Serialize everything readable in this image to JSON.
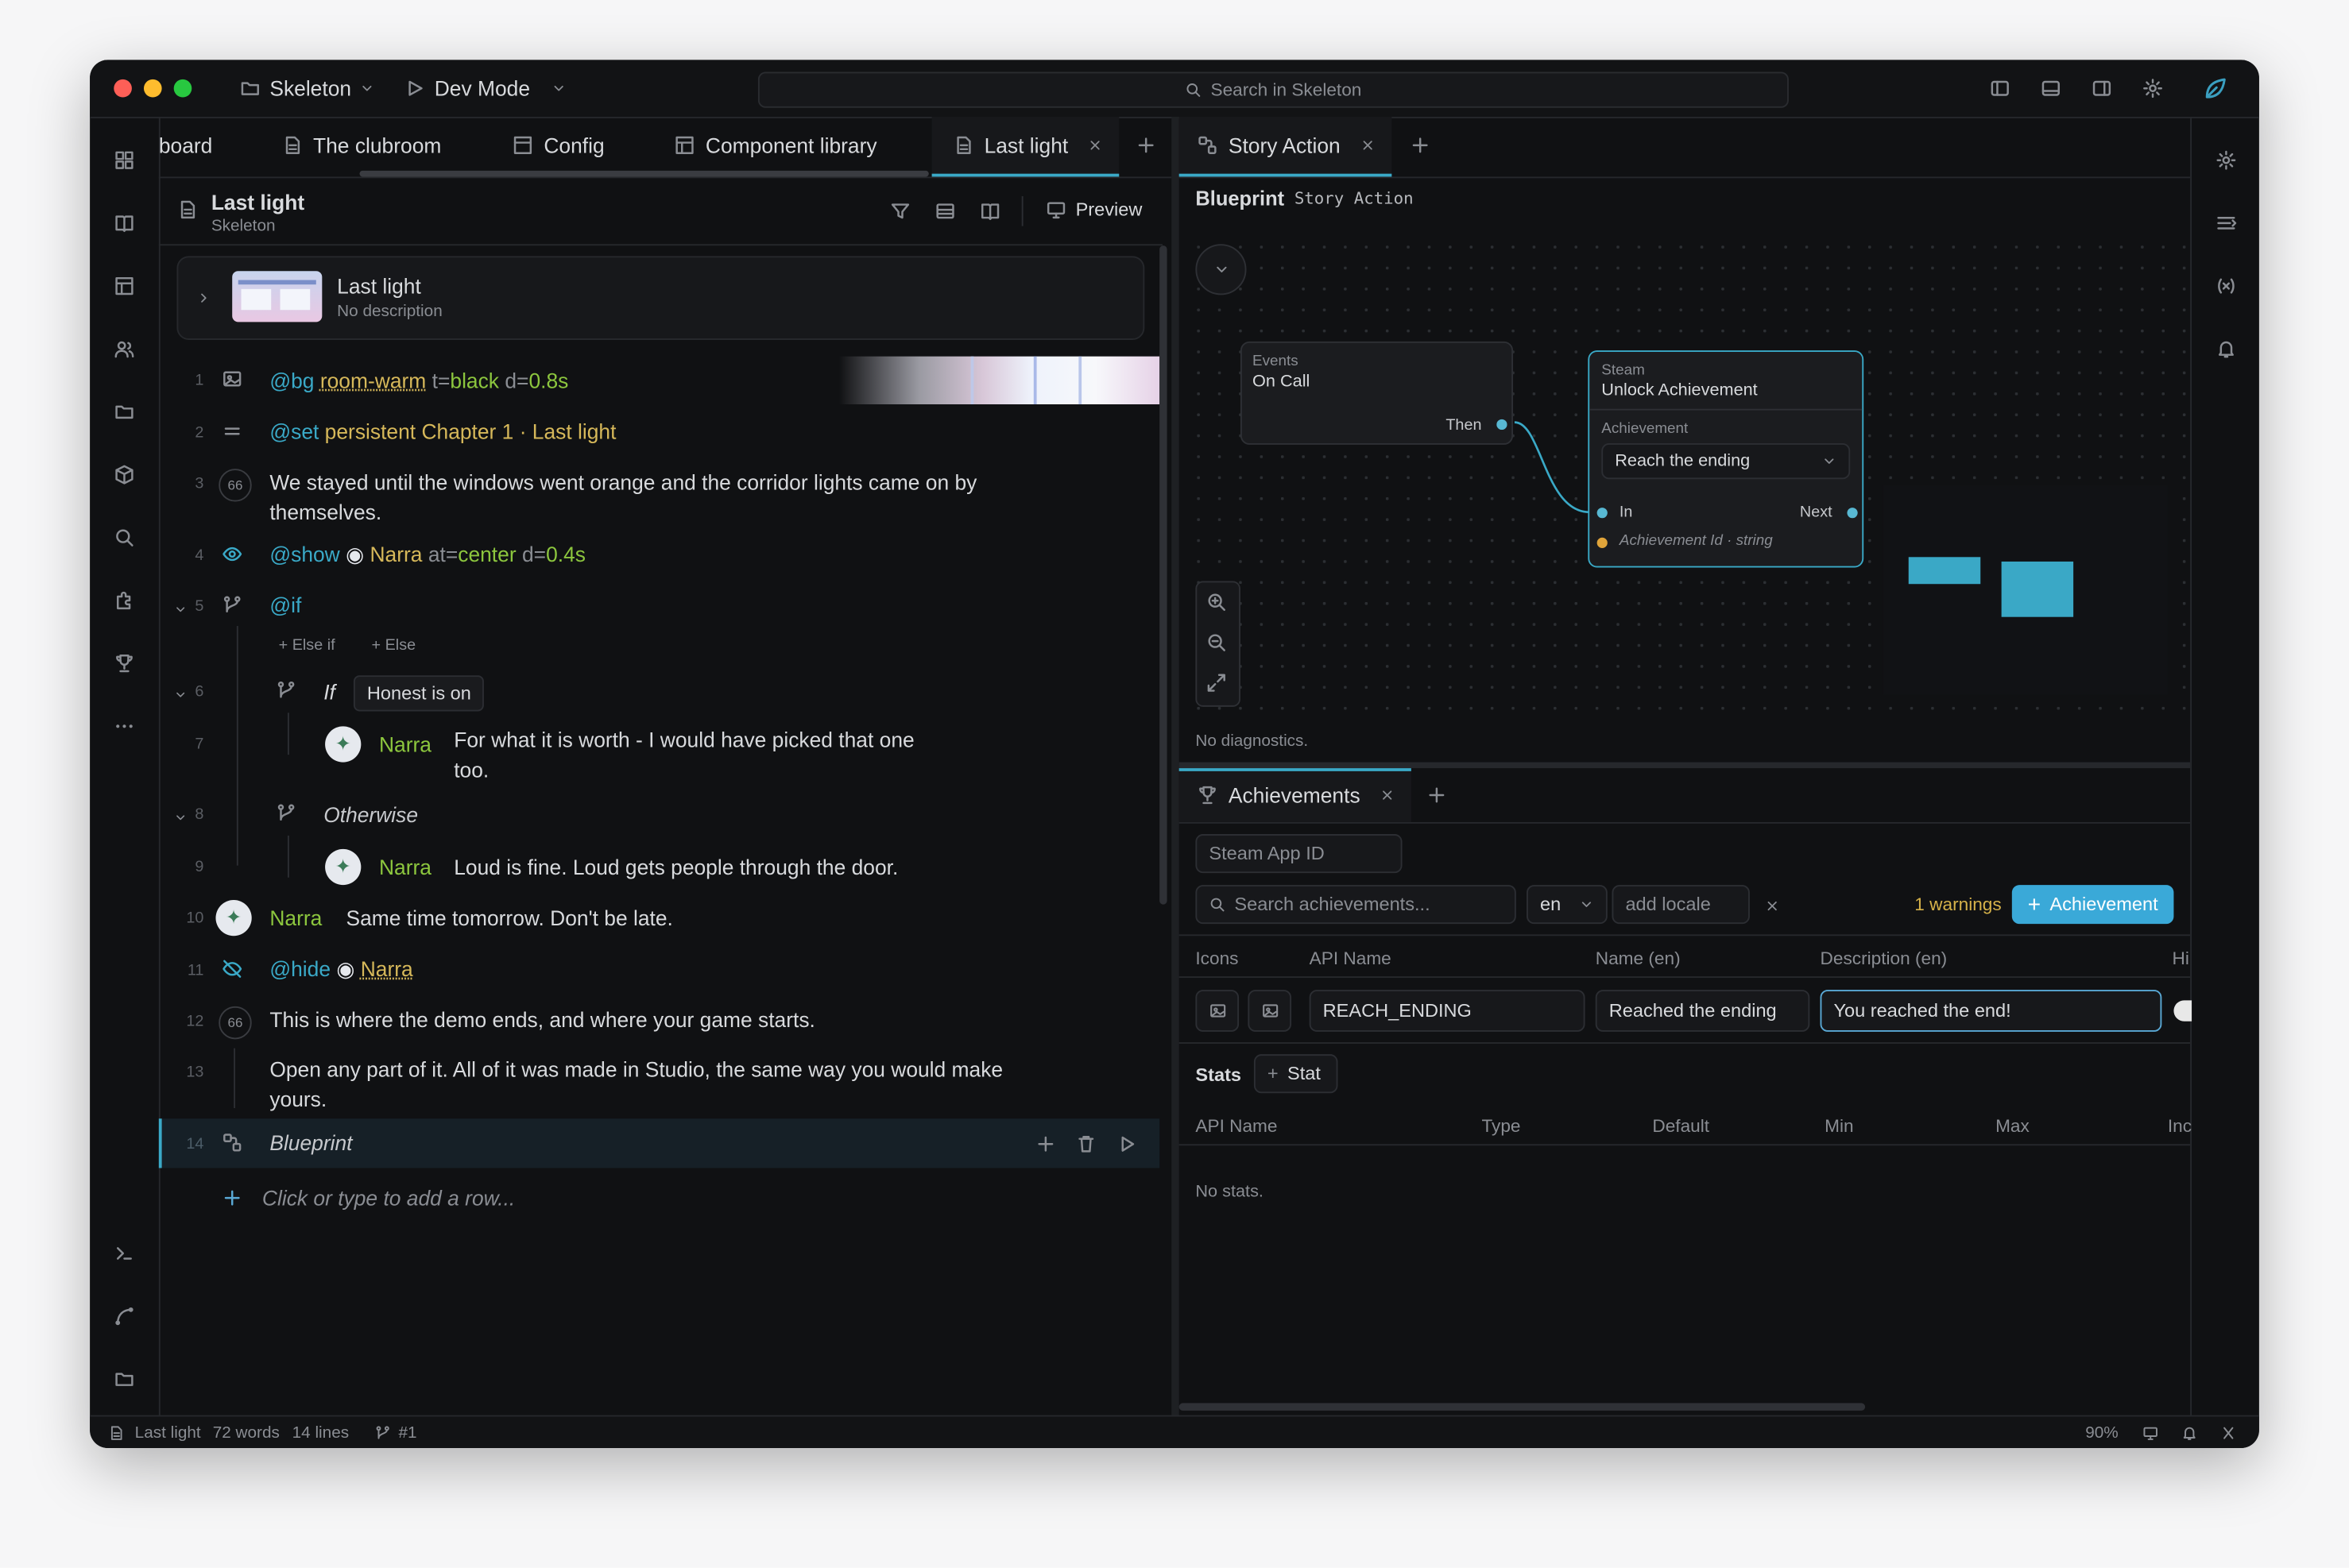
{
  "titlebar": {
    "project": "Skeleton",
    "mode": "Dev Mode",
    "search_placeholder": "Search in Skeleton"
  },
  "left_tabs": [
    "board",
    "The clubroom",
    "Config",
    "Component library",
    "Last light"
  ],
  "doc": {
    "title": "Last light",
    "subtitle": "Skeleton",
    "preview": "Preview",
    "card_title": "Last light",
    "card_desc": "No description"
  },
  "lines": {
    "l1": {
      "n": "1",
      "cmd": "@bg",
      "a": "room-warm",
      "b": "t=",
      "bv": "black",
      "c": "d=",
      "cv": "0.8s"
    },
    "l2": {
      "n": "2",
      "cmd": "@set",
      "a": "persistent",
      "b": "Chapter 1 · Last light"
    },
    "l3": {
      "n": "3",
      "text": "We stayed until the windows went orange and the corridor lights came on by themselves."
    },
    "l4": {
      "n": "4",
      "cmd": "@show",
      "a": "Narra",
      "b": "at=",
      "bv": "center",
      "c": "d=",
      "cv": "0.4s"
    },
    "l5": {
      "n": "5",
      "cmd": "@if",
      "elseif": "+ Else if",
      "else": "+ Else"
    },
    "l6": {
      "n": "6",
      "kw": "If",
      "cond": "Honest is on"
    },
    "l7": {
      "n": "7",
      "who": "Narra",
      "text": "For what it is worth - I would have picked that one too."
    },
    "l8": {
      "n": "8",
      "kw": "Otherwise"
    },
    "l9": {
      "n": "9",
      "who": "Narra",
      "text": "Loud is fine. Loud gets people through the door."
    },
    "l10": {
      "n": "10",
      "who": "Narra",
      "text": "Same time tomorrow. Don't be late."
    },
    "l11": {
      "n": "11",
      "cmd": "@hide",
      "a": "Narra"
    },
    "l12": {
      "n": "12",
      "text": "This is where the demo ends, and where your game starts."
    },
    "l13": {
      "n": "13",
      "text": "Open any part of it. All of it was made in Studio, the same way you would make yours."
    },
    "l14": {
      "n": "14",
      "text": "Blueprint"
    },
    "add": "Click or type to add a row..."
  },
  "right": {
    "tab": "Story Action",
    "bp_title": "Blueprint",
    "bp_sub": "Story Action",
    "node1": {
      "cat": "Events",
      "name": "On Call",
      "out": "Then"
    },
    "node2": {
      "cat": "Steam",
      "name": "Unlock Achievement",
      "label": "Achievement",
      "value": "Reach the ending",
      "in": "In",
      "out": "Next",
      "param": "Achievement Id · string"
    },
    "diag": "No diagnostics."
  },
  "ach": {
    "tab": "Achievements",
    "steam_placeholder": "Steam App ID",
    "search_placeholder": "Search achievements...",
    "locale": "en",
    "add_locale": "add locale",
    "warnings": "1 warnings",
    "add_btn": "Achievement",
    "cols": [
      "Icons",
      "API Name",
      "Name (en)",
      "Description (en)",
      "Hi"
    ],
    "row": {
      "api": "REACH_ENDING",
      "name": "Reached the ending",
      "desc": "You reached the end!"
    },
    "stats": "Stats",
    "stat_btn": "Stat",
    "stat_cols": [
      "API Name",
      "Type",
      "Default",
      "Min",
      "Max",
      "Inc"
    ],
    "no_stats": "No stats."
  },
  "status": {
    "doc": "Last light",
    "words": "72 words",
    "lines": "14 lines",
    "branch": "#1",
    "zoom": "90%"
  }
}
